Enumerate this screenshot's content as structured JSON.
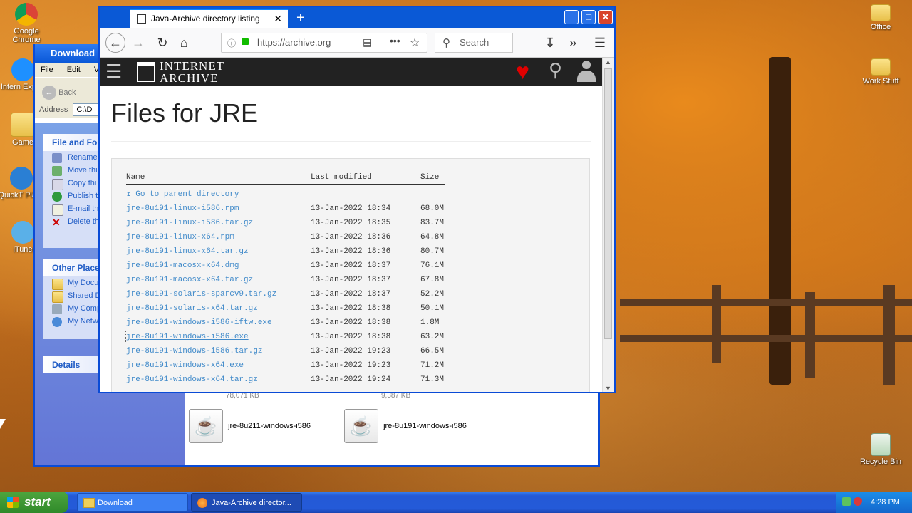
{
  "desktop": {
    "left_icons": [
      {
        "label": "Google Chrome",
        "short": "Google Chrome"
      },
      {
        "label": "Internet Explorer",
        "short": "Intern Explor"
      },
      {
        "label": "Games",
        "short": "Game"
      },
      {
        "label": "QuickTime Player",
        "short": "QuickT Playe"
      },
      {
        "label": "iTunes",
        "short": "iTune"
      }
    ],
    "right_icons": [
      {
        "label": "Office"
      },
      {
        "label": "Work Stuff"
      },
      {
        "label": "Recycle Bin"
      }
    ]
  },
  "explorer": {
    "title": "Download",
    "menu": [
      "File",
      "Edit",
      "Vie"
    ],
    "back_label": "Back",
    "address_label": "Address",
    "address_value": "C:\\D",
    "file_folder_tasks": {
      "header": "File and Fol",
      "items": [
        "Rename",
        "Move thi",
        "Copy thi",
        "Publish t",
        "E-mail th",
        "Delete th"
      ]
    },
    "other_places": {
      "header": "Other Place",
      "items": [
        "My Docu",
        "Shared D",
        "My Comp",
        "My Netw"
      ]
    },
    "details_header": "Details",
    "files": [
      {
        "name": "jre-8u211-windows-i586",
        "size": "78,071 KB"
      },
      {
        "name": "jre-8u191-windows-i586",
        "size": "9,387 KB"
      }
    ]
  },
  "browser": {
    "tab_title": "Java-Archive directory listing",
    "url": "https://archive.org",
    "search_placeholder": "Search",
    "ia_logo_line1": "INTERNET",
    "ia_logo_line2": "ARCHIVE",
    "page_title": "Files for JRE",
    "columns": {
      "name": "Name",
      "modified": "Last modified",
      "size": "Size"
    },
    "parent_link": "Go to parent directory",
    "files": [
      {
        "name": "jre-8u191-linux-i586.rpm",
        "modified": "13-Jan-2022 18:34",
        "size": "68.0M"
      },
      {
        "name": "jre-8u191-linux-i586.tar.gz",
        "modified": "13-Jan-2022 18:35",
        "size": "83.7M"
      },
      {
        "name": "jre-8u191-linux-x64.rpm",
        "modified": "13-Jan-2022 18:36",
        "size": "64.8M"
      },
      {
        "name": "jre-8u191-linux-x64.tar.gz",
        "modified": "13-Jan-2022 18:36",
        "size": "80.7M"
      },
      {
        "name": "jre-8u191-macosx-x64.dmg",
        "modified": "13-Jan-2022 18:37",
        "size": "76.1M"
      },
      {
        "name": "jre-8u191-macosx-x64.tar.gz",
        "modified": "13-Jan-2022 18:37",
        "size": "67.8M"
      },
      {
        "name": "jre-8u191-solaris-sparcv9.tar.gz",
        "modified": "13-Jan-2022 18:37",
        "size": "52.2M"
      },
      {
        "name": "jre-8u191-solaris-x64.tar.gz",
        "modified": "13-Jan-2022 18:38",
        "size": "50.1M"
      },
      {
        "name": "jre-8u191-windows-i586-iftw.exe",
        "modified": "13-Jan-2022 18:38",
        "size": "1.8M"
      },
      {
        "name": "jre-8u191-windows-i586.exe",
        "modified": "13-Jan-2022 18:38",
        "size": "63.2M"
      },
      {
        "name": "jre-8u191-windows-i586.tar.gz",
        "modified": "13-Jan-2022 19:23",
        "size": "66.5M"
      },
      {
        "name": "jre-8u191-windows-x64.exe",
        "modified": "13-Jan-2022 19:23",
        "size": "71.2M"
      },
      {
        "name": "jre-8u191-windows-x64.tar.gz",
        "modified": "13-Jan-2022 19:24",
        "size": "71.3M"
      }
    ],
    "hovered_file": "jre-8u191-windows-i586.exe"
  },
  "taskbar": {
    "start_label": "start",
    "buttons": [
      {
        "label": "Download"
      },
      {
        "label": "Java-Archive director..."
      }
    ],
    "clock": "4:28 PM"
  },
  "colors": {
    "link": "#428bca",
    "xp_blue": "#0a4bd6",
    "ia_heart": "#e00000"
  }
}
